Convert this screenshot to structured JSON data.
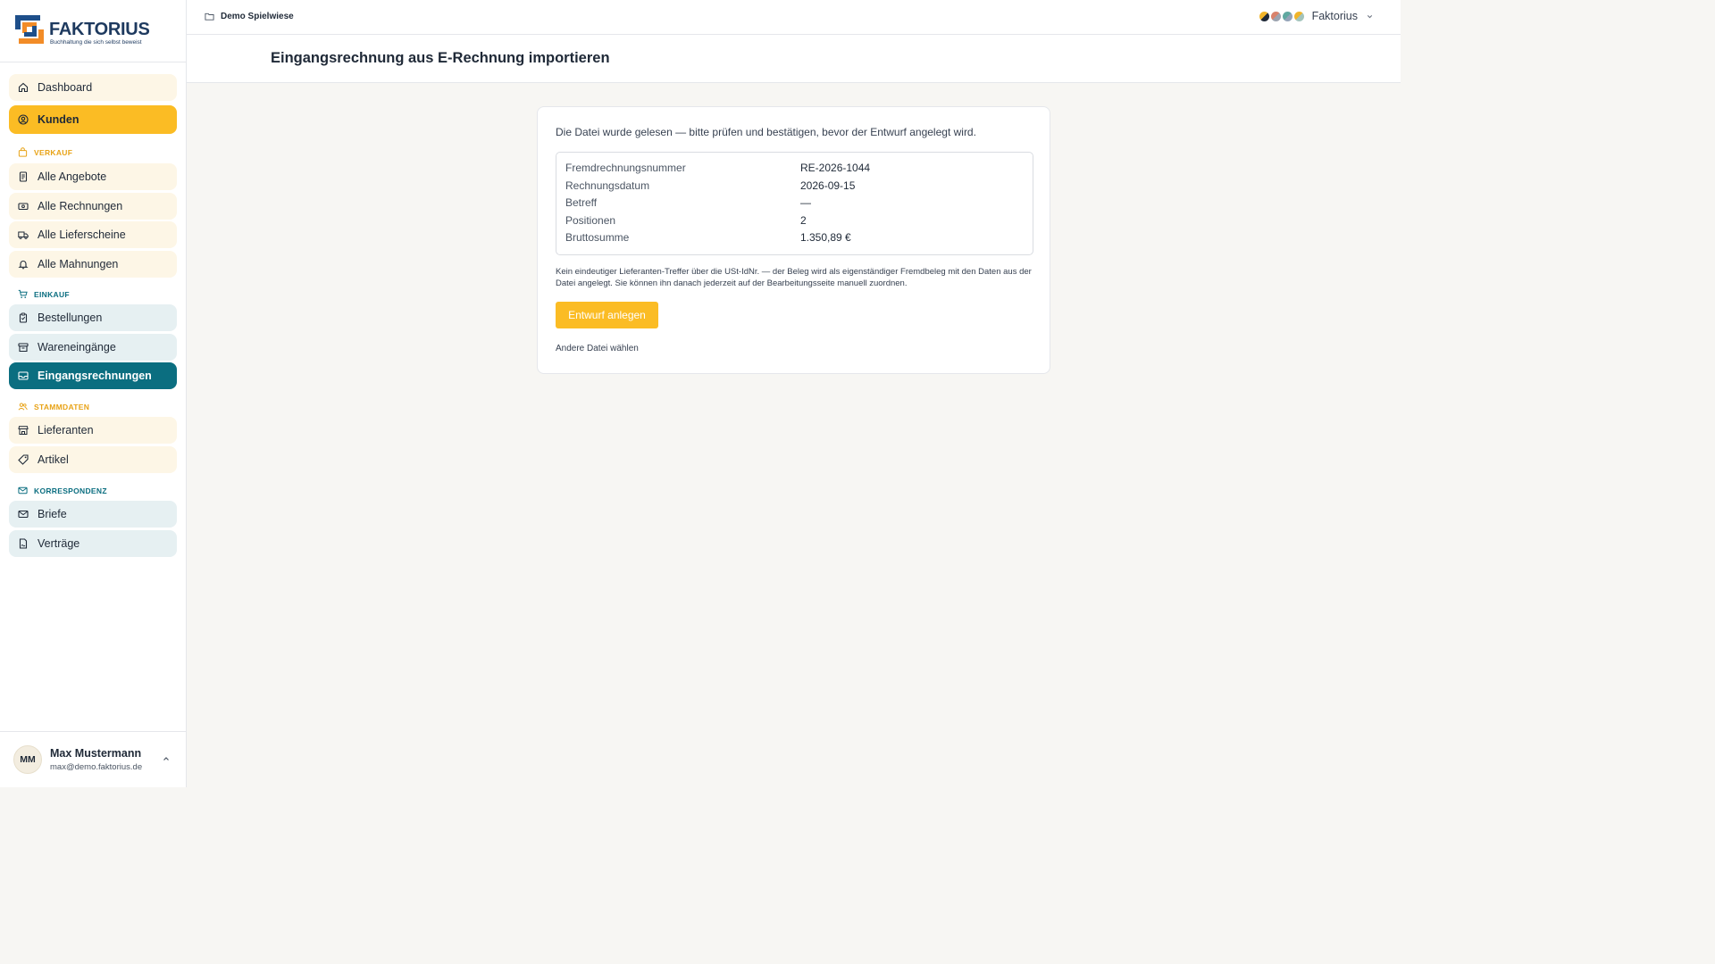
{
  "brand": {
    "name": "FAKTORIUS",
    "tagline": "Buchhaltung die sich selbst beweist"
  },
  "sidebar": {
    "top_items": [
      {
        "label": "Dashboard",
        "icon": "home-icon"
      },
      {
        "label": "Kunden",
        "icon": "user-circle-icon",
        "active": true
      }
    ],
    "sections": [
      {
        "title": "VERKAUF",
        "icon": "bag-icon",
        "items": [
          {
            "label": "Alle Angebote",
            "icon": "document-icon"
          },
          {
            "label": "Alle Rechnungen",
            "icon": "banknote-icon"
          },
          {
            "label": "Alle Lieferscheine",
            "icon": "truck-icon"
          },
          {
            "label": "Alle Mahnungen",
            "icon": "bell-icon"
          }
        ]
      },
      {
        "title": "EINKAUF",
        "icon": "cart-icon",
        "items": [
          {
            "label": "Bestellungen",
            "icon": "clipboard-icon"
          },
          {
            "label": "Wareneingänge",
            "icon": "archive-icon"
          },
          {
            "label": "Eingangsrechnungen",
            "icon": "inbox-icon",
            "active": true
          }
        ]
      },
      {
        "title": "STAMMDATEN",
        "icon": "users-icon",
        "items": [
          {
            "label": "Lieferanten",
            "icon": "store-icon"
          },
          {
            "label": "Artikel",
            "icon": "tag-icon"
          }
        ]
      },
      {
        "title": "KORRESPONDENZ",
        "icon": "mail-icon",
        "items": [
          {
            "label": "Briefe",
            "icon": "mail-icon"
          },
          {
            "label": "Verträge",
            "icon": "file-signature-icon"
          }
        ]
      }
    ],
    "user": {
      "initials": "MM",
      "name": "Max Mustermann",
      "email": "max@demo.faktorius.de"
    }
  },
  "topbar": {
    "breadcrumb": "Demo Spielwiese",
    "tenant": "Faktorius",
    "theme_dot_colors": [
      "#1f2937",
      "#d9826b",
      "#5fa8a0",
      "#f0b429"
    ]
  },
  "page": {
    "title": "Eingangsrechnung aus E-Rechnung importieren"
  },
  "card": {
    "intro": "Die Datei wurde gelesen — bitte prüfen und bestätigen, bevor der Entwurf angelegt wird.",
    "details": [
      {
        "label": "Fremdrechnungsnummer",
        "value": "RE-2026-1044"
      },
      {
        "label": "Rechnungsdatum",
        "value": "2026-09-15"
      },
      {
        "label": "Betreff",
        "value": "—"
      },
      {
        "label": "Positionen",
        "value": "2"
      },
      {
        "label": "Bruttosumme",
        "value": "1.350,89 €"
      }
    ],
    "note": "Kein eindeutiger Lieferanten-Treffer über die USt-IdNr. — der Beleg wird als eigenständiger Fremdbeleg mit den Daten aus der Datei angelegt. Sie können ihn danach jederzeit auf der Bearbeitungsseite manuell zuordnen.",
    "primary_button": "Entwurf anlegen",
    "secondary_link": "Andere Datei wählen"
  },
  "colors": {
    "amber": "#fbbc24",
    "amber_light": "#fdf6e6",
    "teal": "#0b6e80",
    "teal_light": "#e6f0f2",
    "background": "#f7f6f3"
  }
}
